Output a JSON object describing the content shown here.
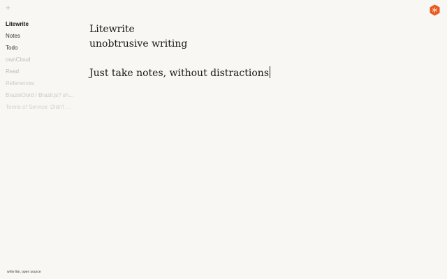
{
  "toolbar": {
    "add_label": "+"
  },
  "sidebar": {
    "items": [
      {
        "label": "Litewrite"
      },
      {
        "label": "Notes"
      },
      {
        "label": "Todo"
      },
      {
        "label": "ownCloud"
      },
      {
        "label": "Read"
      },
      {
        "label": "References"
      },
      {
        "label": "BrazeiOord / Brazil.js? she..."
      },
      {
        "label": "Terms of Service: Didn't Re..."
      }
    ]
  },
  "editor": {
    "lines": [
      "Litewrite",
      "unobtrusive writing",
      "",
      "Just take notes, without distractions"
    ]
  },
  "logo": {
    "icon": "litewrite-logo-icon",
    "color": "#e85a1f"
  },
  "footer": {
    "text": "write lite, open source"
  }
}
